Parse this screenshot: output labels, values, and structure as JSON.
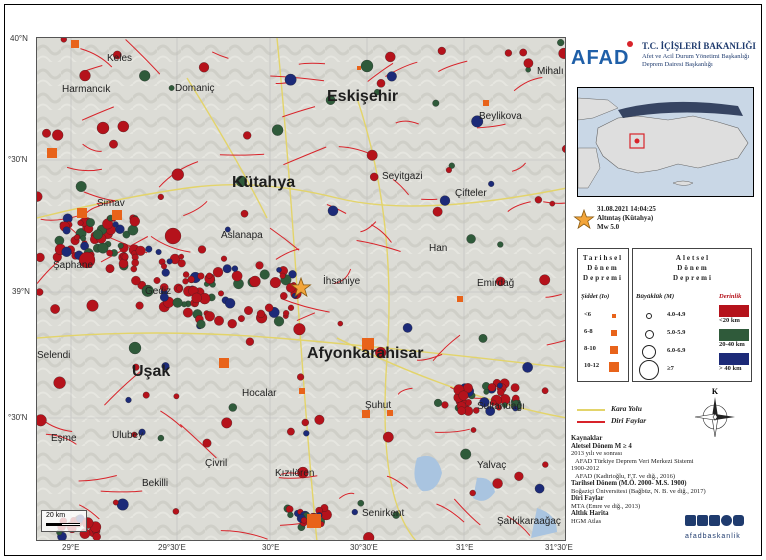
{
  "map": {
    "lat_labels": [
      "40°N",
      "°30'N",
      "39°N",
      "°30'N"
    ],
    "lon_labels": [
      "29°E",
      "29°30'E",
      "30°E",
      "30°30'E",
      "31°E",
      "31°30'E"
    ],
    "places_big": [
      "Eskişehir",
      "Kütahya",
      "Afyonkarahisar",
      "Uşak"
    ],
    "places": [
      "Keles",
      "Domaniç",
      "Harmancık",
      "Mihalı",
      "Beylikova",
      "Seyitgazi",
      "Çifteler",
      "Aslanapa",
      "Han",
      "İhsaniye",
      "Emirdağ",
      "Şaphane",
      "Gediz",
      "Simav",
      "Hocalar",
      "Şuhut",
      "Sultandağı",
      "Eşme",
      "Ulubey",
      "Çivril",
      "Kızılören",
      "Bekilli",
      "Yalvaç",
      "Senirkent",
      "Şarkikaraağaç",
      "Selendi"
    ],
    "scale_bar": "20 km",
    "earthquake_colors": {
      "shallow": "#b5121b",
      "mid": "#2f5a3a",
      "deep": "#1c2a78"
    },
    "historical_color": "#e8631a",
    "fault_color": "#d8232a",
    "road_color": "#e3d46a",
    "epicenter_color": "#f3a53a"
  },
  "header": {
    "logo": "AFAD",
    "ministry": "T.C. İÇİŞLERİ BAKANLIĞI",
    "dept_line1": "Afet ve Acil Durum Yönetimi Başkanlığı",
    "dept_line2": "Deprem Dairesi Başkanlığı"
  },
  "event": {
    "datetime": "31.08.2021 14:04:25",
    "location": "Altıntaş (Kütahya)",
    "magnitude": "Mw 5.0"
  },
  "legend": {
    "historical_title": [
      "Tarihsel",
      "Dönem",
      "Depremi"
    ],
    "intensity_title": "Şiddet (Io)",
    "intensity_classes": [
      "<6",
      "6-8",
      "8-10",
      "10-12"
    ],
    "instrumental_title": [
      "Aletsel",
      "Dönem",
      "Depremi"
    ],
    "magnitude_title": "Büyüklük (M)",
    "magnitude_classes": [
      "4.0-4.9",
      "5.0-5.9",
      "6.0-6.9",
      "≥7"
    ],
    "depth_title": "Derinlik",
    "depth_classes": [
      "<20 km",
      "20-40 km",
      "> 40 km"
    ],
    "road": "Kara Yolu",
    "fault": "Diri Faylar",
    "north": "K"
  },
  "sources": {
    "title": "Kaynaklar",
    "s1_title": "Aletsel Dönem M ≥ 4",
    "s1_l1": "2013 yılı ve sonrası",
    "s1_l2": "AFAD Türkiye Deprem Veri Merkezi Sistemi",
    "s1_l3": "1900-2012",
    "s1_l4": "AFAD (Kadirioğlu, F.T. ve diğ., 2016)",
    "s2_title": "Tarihsel Dönem (M.Ö. 2000- M.S. 1900)",
    "s2_l1": "Boğaziçi Üniversitesi (Bağbüz, N. B. ve diğ., 2017)",
    "s3_title": "Diri Faylar",
    "s3_l1": "MTA (Emre ve diğ., 2013)",
    "s4_title": "Altlık Harita",
    "s4_l1": "HGM Atlas",
    "social_handle": "afadbaskanlik"
  }
}
